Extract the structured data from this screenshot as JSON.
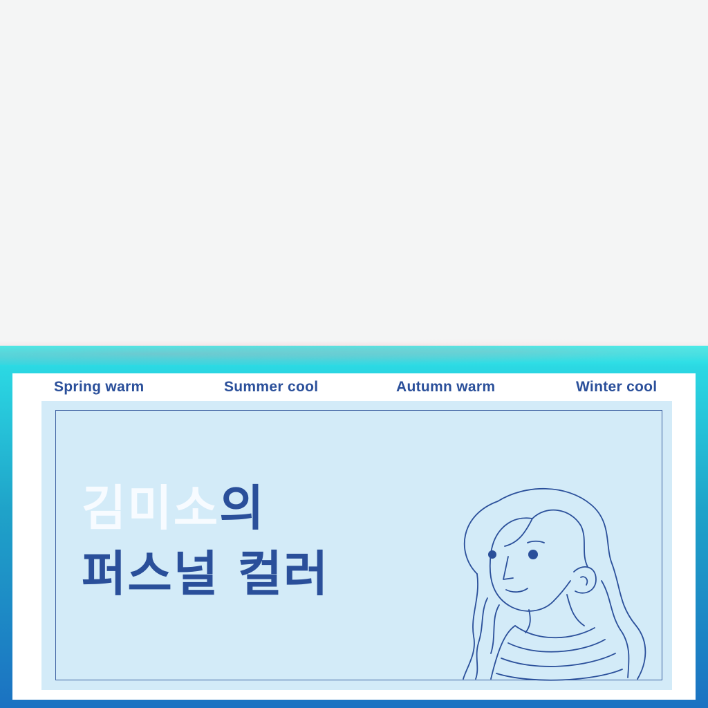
{
  "tabs": [
    "Spring warm",
    "Summer cool",
    "Autumn warm",
    "Winter cool"
  ],
  "title": {
    "name": "김미소",
    "suffix": "의",
    "line2": "퍼스널 컬러"
  },
  "colors": {
    "accent": "#2a4f9a",
    "panel": "#d3ebf8",
    "band_top": "#3ef2ee",
    "band_bottom": "#1b72c2"
  },
  "icons": [
    "woman-portrait-illustration"
  ]
}
